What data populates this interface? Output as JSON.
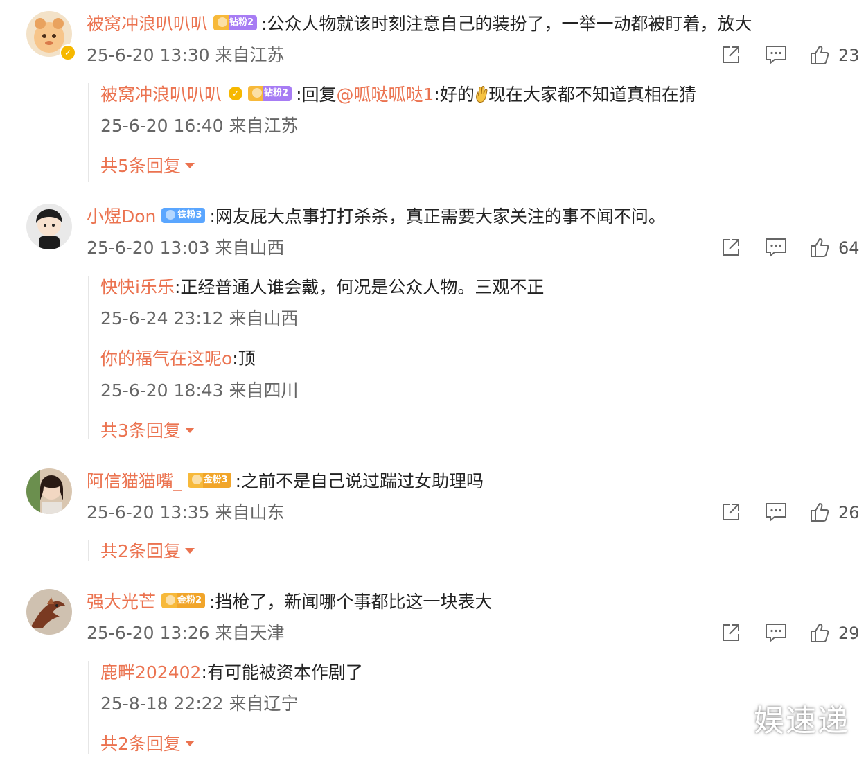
{
  "comments": [
    {
      "user": "被窝冲浪叭叭叭",
      "fan_badge": "钻粉2",
      "text": ":公众人物就该时刻注意自己的装扮了，一举一动都被盯着，放大",
      "meta": "25-6-20 13:30 来自江苏",
      "likes": "23",
      "verified_mark": "✓",
      "replies": [
        {
          "user": "被窝冲浪叭叭叭",
          "verified_mark": "✓",
          "fan_badge": "钻粉2",
          "prefix": ":回复",
          "mention": "@呱哒呱哒1",
          "text": ":好的",
          "text2": "现在大家都不知道真相在猜",
          "meta": "25-6-20 16:40 来自江苏"
        }
      ],
      "more": "共5条回复"
    },
    {
      "user": "小煜Don",
      "fan_badge": "铁粉3",
      "text": ":网友屁大点事打打杀杀，真正需要大家关注的事不闻不问。",
      "meta": "25-6-20 13:03 来自山西",
      "likes": "64",
      "replies": [
        {
          "user": "快快i乐乐",
          "text": ":正经普通人谁会戴，何况是公众人物。三观不正",
          "meta": "25-6-24 23:12 来自山西"
        },
        {
          "user": "你的福气在这呢o",
          "text": ":顶",
          "meta": "25-6-20 18:43 来自四川"
        }
      ],
      "more": "共3条回复"
    },
    {
      "user": "阿信猫猫嘴_",
      "fan_badge": "金粉3",
      "text": ":之前不是自己说过踹过女助理吗",
      "meta": "25-6-20 13:35 来自山东",
      "likes": "26",
      "replies": [],
      "more": "共2条回复"
    },
    {
      "user": "强大光芒",
      "fan_badge": "金粉2",
      "text": ":挡枪了，新闻哪个事都比这一块表大",
      "meta": "25-6-20 13:26 来自天津",
      "likes": "29",
      "replies": [
        {
          "user": "鹿畔202402",
          "text": ":有可能被资本作剧了",
          "meta": "25-8-18 22:22 来自辽宁"
        }
      ],
      "more": "共2条回复"
    }
  ],
  "watermark": "娱速递",
  "icons": {
    "share": "share-icon",
    "comment": "comment-icon",
    "like": "like-icon",
    "expand": "triangle-down-icon"
  },
  "colors": {
    "username": "#eb7350",
    "text": "#222222",
    "meta": "#666666",
    "verified": "#f6b800"
  }
}
